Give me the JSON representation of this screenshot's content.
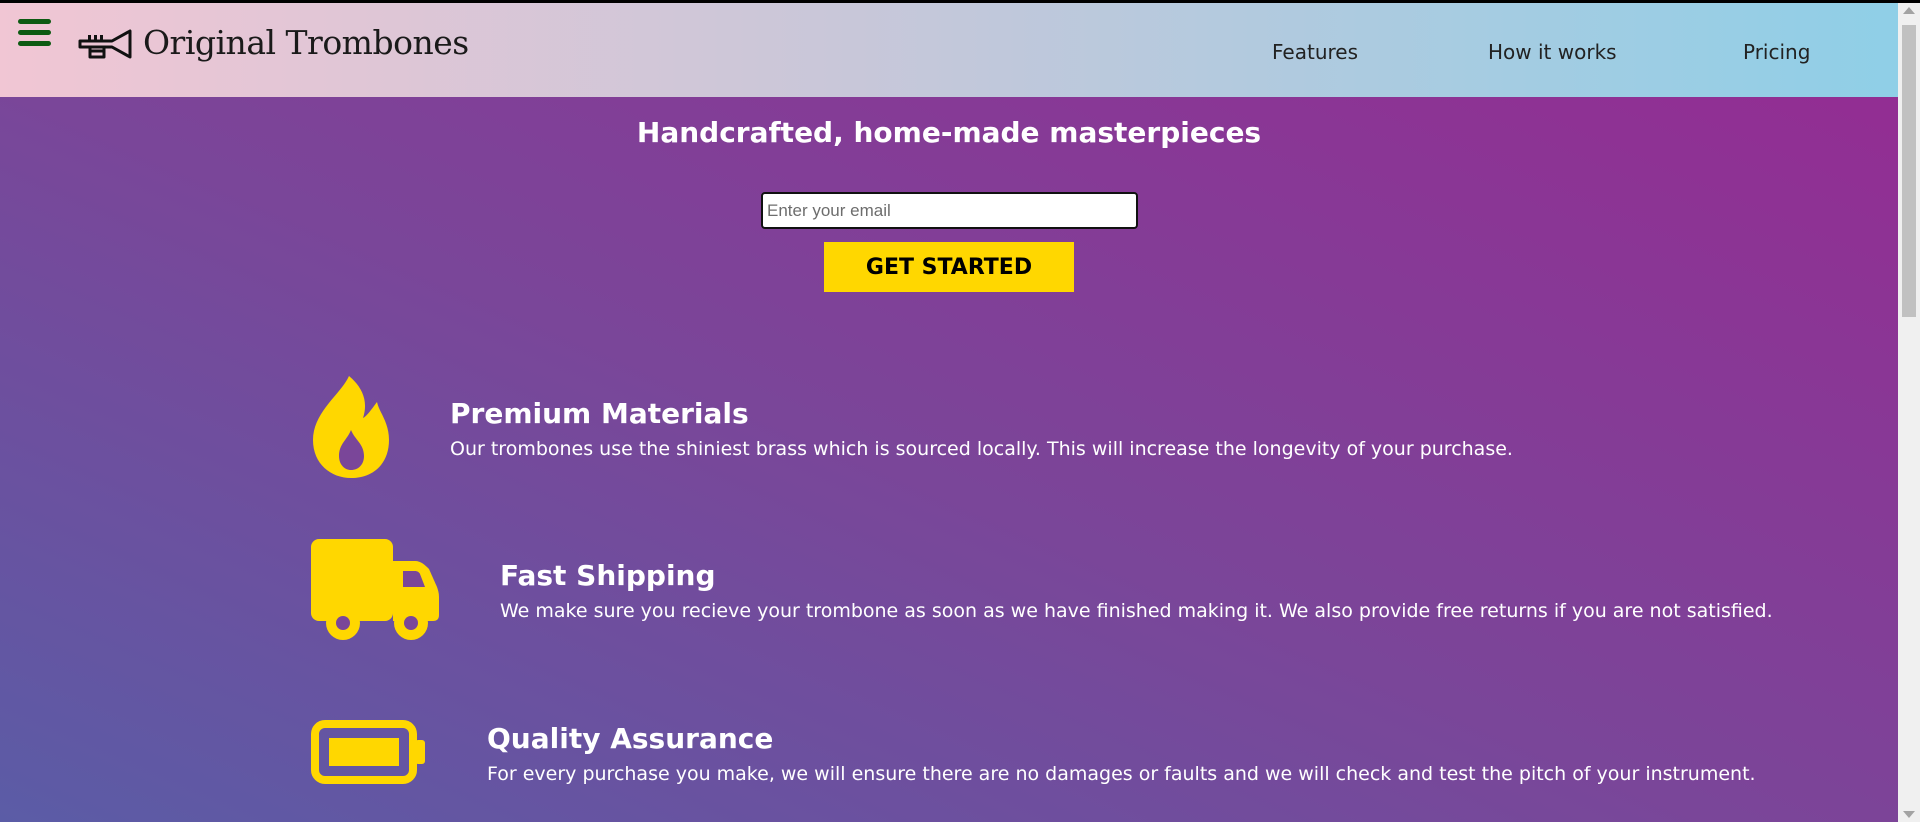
{
  "header": {
    "brand": "Original Trombones",
    "nav": [
      "Features",
      "How it works",
      "Pricing"
    ]
  },
  "hero": {
    "title": "Handcrafted, home-made masterpieces",
    "email_placeholder": "Enter your email",
    "email_value": "",
    "cta_label": "GET STARTED"
  },
  "features": [
    {
      "icon": "fire-icon",
      "title": "Premium Materials",
      "desc": "Our trombones use the shiniest brass which is sourced locally. This will increase the longevity of your purchase."
    },
    {
      "icon": "truck-icon",
      "title": "Fast Shipping",
      "desc": "We make sure you recieve your trombone as soon as we have finished making it. We also provide free returns if you are not satisfied."
    },
    {
      "icon": "battery-icon",
      "title": "Quality Assurance",
      "desc": "For every purchase you make, we will ensure there are no damages or faults and we will check and test the pitch of your instrument."
    }
  ],
  "colors": {
    "accent": "#ffd700",
    "hamburger": "#0d5a12",
    "text": "#ffffff"
  }
}
